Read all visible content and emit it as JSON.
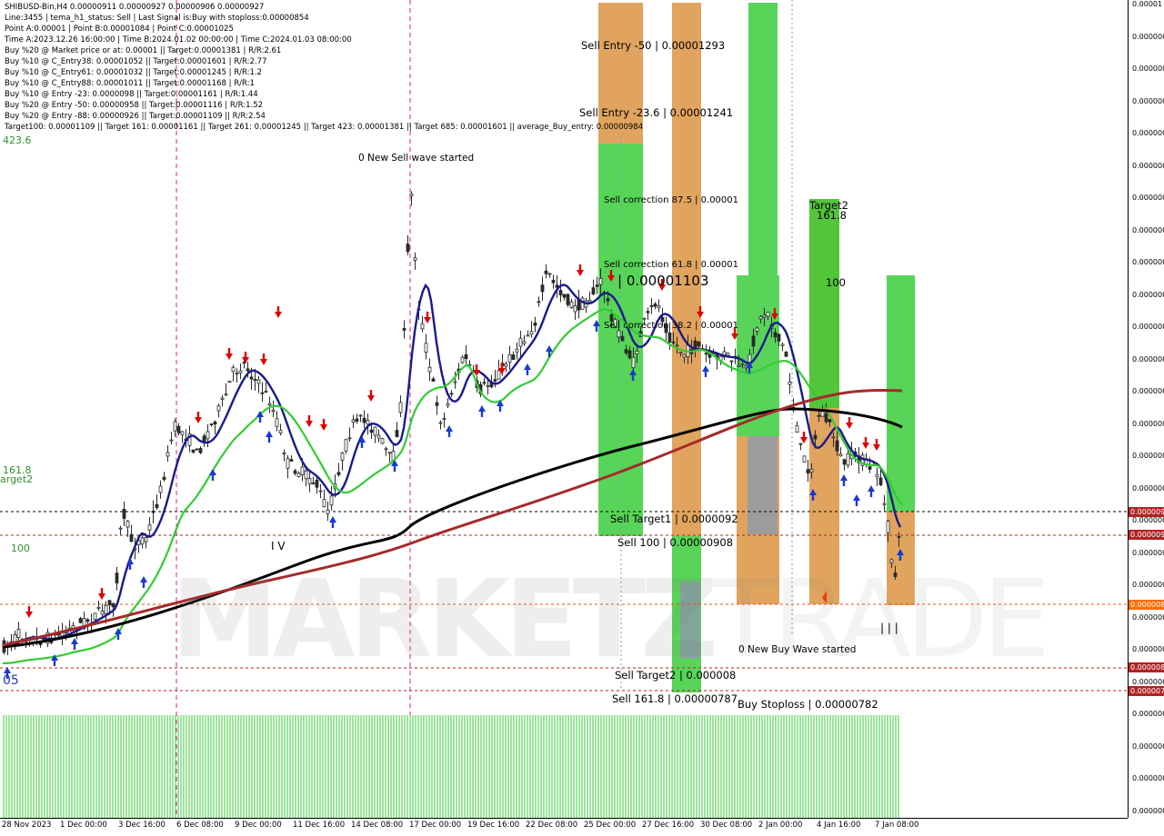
{
  "chart_data": {
    "type": "candlestick",
    "symbol_header": "SHIBUSD-Bin,H4  0.00000911 0.00000927 0.00000906 0.00000927",
    "info_lines": [
      "Line:3455 | tema_h1_status: Sell | Last Signal is:Buy with stoploss:0.00000854",
      "Point A:0.00001 | Point B:0.00001084 | Point C:0.00001025",
      "Time A:2023.12.26 16:00:00 | Time B:2024.01.02 00:00:00 | Time C:2024.01.03 08:00:00",
      "Buy %20 @ Market price or at: 0.00001 || Target:0.00001381 | R/R:2.61",
      "Buy %10 @ C_Entry38: 0.00001052 || Target:0.00001601 | R/R:2.77",
      "Buy %10 @ C_Entry61: 0.00001032 || Target:0.00001245 | R/R:1.2",
      "Buy %10 @ C_Entry88: 0.00001011 || Target:0.00001168 | R/R:1",
      "Buy %10 @ Entry -23: 0.0000098 || Target:0.00001161 | R/R:1.44",
      "Buy %20 @ Entry -50: 0.00000958 || Target:0.00001116 | R/R:1.52",
      "Buy %20 @ Entry -88: 0.00000926 || Target:0.00001109 || R/R:2.54",
      "Target100: 0.00001109 || Target 161: 0.00001161 || Target 261: 0.00001245 || Target 423: 0.00001381 || Target 685: 0.00001601 || average_Buy_entry: 0.00000984"
    ],
    "x_ticks": [
      "28 Nov 2023",
      "1 Dec 00:00",
      "3 Dec 16:00",
      "6 Dec 08:00",
      "9 Dec 00:00",
      "11 Dec 16:00",
      "14 Dec 08:00",
      "17 Dec 00:00",
      "19 Dec 16:00",
      "22 Dec 08:00",
      "25 Dec 00:00",
      "27 Dec 16:00",
      "30 Dec 08:00",
      "2 Jan 00:00",
      "4 Jan 16:00",
      "7 Jan 08:00"
    ],
    "y_tick_label": "0.000000",
    "y_tick_top_label": "0.00001",
    "left_labels": {
      "a": "423.6",
      "b": "161.8",
      "c": "arget2",
      "d": "100",
      "e": "05"
    },
    "levels": [
      {
        "key": "sell_entry_50",
        "text": "Sell Entry -50 | 0.00001293",
        "color": "#555555"
      },
      {
        "key": "sell_entry_236",
        "text": "Sell Entry -23.6 | 0.00001241",
        "color": "#555555"
      },
      {
        "key": "sell_corr_875",
        "text": "Sell correction 87.5 | 0.00001",
        "color": "#1a3a9a"
      },
      {
        "key": "sell_corr_618",
        "text": "Sell correction 61.8 | 0.00001",
        "color": "#1a3a9a"
      },
      {
        "key": "big_value",
        "text": "| 0.00001103",
        "color": "#1a3a9a"
      },
      {
        "key": "sell_corr_382",
        "text": "Sell correction 38.2 | 0.00001",
        "color": "#1a3a9a"
      },
      {
        "key": "sell_target1",
        "text": "Sell Target1 | 0.0000092",
        "color": "#b22222"
      },
      {
        "key": "sell_100",
        "text": "Sell 100 | 0.00000908",
        "color": "#b22222"
      },
      {
        "key": "sell_target2",
        "text": "Sell Target2 | 0.000008",
        "color": "#b22222"
      },
      {
        "key": "sell_1618",
        "text": "Sell 161.8 | 0.00000787",
        "color": "#b22222"
      },
      {
        "key": "buy_stoploss",
        "text": "Buy Stoploss | 0.00000782",
        "color": "#e05a00"
      },
      {
        "key": "new_sell_wave",
        "text": "0 New Sell wave started",
        "color": "#000000"
      },
      {
        "key": "new_buy_wave",
        "text": "0 New Buy Wave started",
        "color": "#1a3acc"
      },
      {
        "key": "target2",
        "text": "Target2",
        "color": "#2f8f2f"
      },
      {
        "key": "l1618",
        "text": "161.8",
        "color": "#2f8f2f"
      },
      {
        "key": "l100",
        "text": "100",
        "color": "#2f8f2f"
      },
      {
        "key": "iv",
        "text": "I V",
        "color": "#1a3acc"
      },
      {
        "key": "bars",
        "text": "| | |",
        "color": "#000000"
      }
    ],
    "price_boxes": [
      {
        "text": "0.000009",
        "color": "#b22222"
      },
      {
        "text": "0.000009",
        "color": "#b22222"
      },
      {
        "text": "0.000008",
        "color": "#ff6a00"
      },
      {
        "text": "0.000008",
        "color": "#b22222"
      },
      {
        "text": "0.000007",
        "color": "#b22222"
      }
    ],
    "watermark": {
      "bold": "MARKETZ",
      "thin": "TRADE"
    },
    "colors": {
      "bull": "#2a2a2a",
      "bear": "#2a2a2a",
      "ema_fast": "#1a1a8c",
      "ema_mid": "#33cc33",
      "ema_slow": "#000000",
      "ema_red": "#a52a2a",
      "green_box": "#33cc33",
      "orange_box": "#d9903a",
      "histogram": "#33cc33"
    }
  }
}
